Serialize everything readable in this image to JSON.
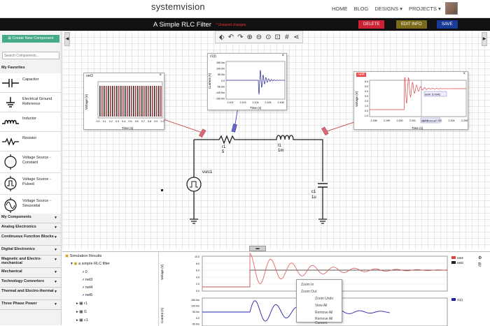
{
  "header": {
    "brand": "systemvision",
    "nav": [
      "HOME",
      "BLOG",
      "DESIGNS ▾",
      "PROJECTS ▾"
    ]
  },
  "titlebar": {
    "title": "A Simple RLC Filter",
    "subtitle": "* Unsaved changes",
    "delete_label": "DELETE",
    "edit_label": "EDIT INFO",
    "save_label": "SAVE"
  },
  "sidebar": {
    "create_label": "Create New Component",
    "search_placeholder": "Search Components...",
    "favorites_header": "My Favorites",
    "favorites": [
      {
        "label": "Capacitor",
        "icon": "capacitor-icon"
      },
      {
        "label": "Electrical Ground Reference",
        "icon": "ground-icon"
      },
      {
        "label": "Inductor",
        "icon": "inductor-icon"
      },
      {
        "label": "Resistor",
        "icon": "resistor-icon"
      },
      {
        "label": "Voltage Source - Constant",
        "icon": "dc-source-icon"
      },
      {
        "label": "Voltage Source - Pulsed",
        "icon": "pulse-source-icon"
      },
      {
        "label": "Voltage Source - Sinusoidal",
        "icon": "sine-source-icon"
      }
    ],
    "categories": [
      "My Components",
      "Analog Electronics",
      "Continuous Function Blocks",
      "Digital Electronics",
      "Magnetic and Electro-mechanical",
      "Mechanical",
      "Technology Converters",
      "Thermal and Electro-thermal",
      "Three Phase Power"
    ]
  },
  "schematic": {
    "labels": {
      "r1": "r1",
      "r1v": "5",
      "l1": "l1",
      "l1v": "1m",
      "c1": "c1",
      "c1v": "1u",
      "src": "vsrc1"
    }
  },
  "probes": {
    "net3": {
      "title": "net3",
      "ylabel": "Voltage (V)",
      "xlabel": "Time (s)",
      "xticks": [
        "0.0",
        "0.1",
        "0.2",
        "0.3",
        "0.4",
        "0.5",
        "0.6",
        "0.7",
        "0.8",
        "0.9",
        "1.0"
      ]
    },
    "r1": {
      "title": "r1(i)",
      "ylabel": "Current (A)",
      "xlabel": "Time (s)",
      "yticks": [
        "150.0m",
        "100.0m",
        "50.0m",
        "0.0",
        "-50.0m",
        "-100.0m",
        "-150.0m"
      ],
      "xticks": [
        "2.102",
        "2.103",
        "2.104",
        "2.105",
        "2.106"
      ]
    },
    "net4": {
      "title": "net4",
      "ylabel": "Voltage (V)",
      "xlabel": "Time (s)",
      "yticks": [
        "6.0",
        "5.0",
        "4.0",
        "3.0",
        "2.0",
        "1.0",
        "0.0",
        "-1.0"
      ],
      "xticks": [
        "2.198",
        "2.199",
        "2.200",
        "2.201",
        "2.202",
        "2.203",
        "2.204",
        "2.205"
      ],
      "tip1": "net4: 5.0042",
      "tip2": "t2s: 2.2016"
    }
  },
  "results": {
    "root": "Simulation Results",
    "sim": "a simple RLC filter",
    "items": [
      "0",
      "net3",
      "net4",
      "net5",
      "r1",
      "l1",
      "c1"
    ],
    "top_ylabel": "Voltage (V)",
    "bottom_ylabel": "Current (A)",
    "legend_top": [
      "net4",
      "net3"
    ],
    "legend_bottom": [
      "r1(i)"
    ],
    "yticks_top": [
      "10.0",
      "8.0",
      "6.0",
      "4.0",
      "2.0",
      "0.0"
    ],
    "yticks_bottom": [
      "150.0m",
      "100.0m",
      "50.0m",
      "0.0",
      "-50.0m"
    ],
    "context_menu": [
      "Zoom In",
      "Zoom Out",
      "Zoom Undo",
      "View All",
      "Remove All",
      "Remove All Cursors"
    ]
  }
}
